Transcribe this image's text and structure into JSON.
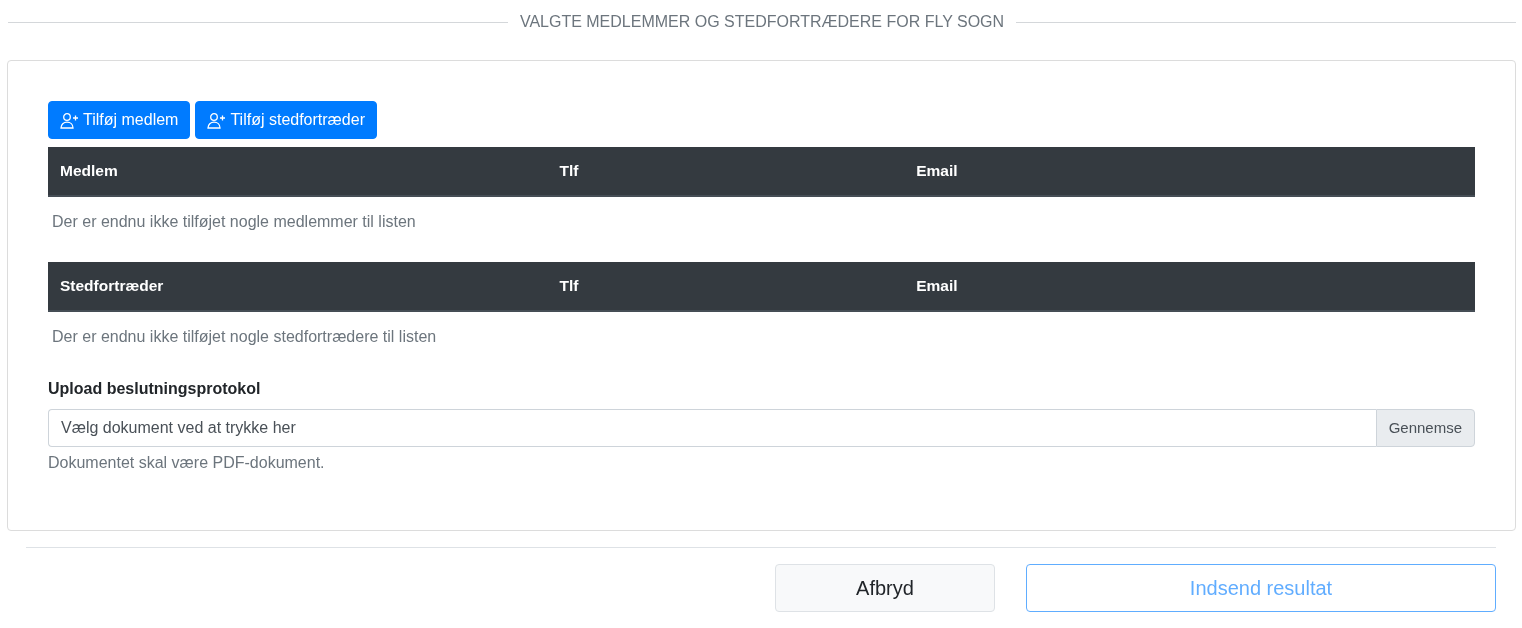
{
  "section_title": "VALGTE MEDLEMMER OG STEDFORTRÆDERE FOR FLY SOGN",
  "actions": [
    {
      "label": "Tilføj medlem"
    },
    {
      "label": "Tilføj stedfortræder"
    }
  ],
  "tables": [
    {
      "columns": [
        "Medlem",
        "Tlf",
        "Email"
      ],
      "empty_message": "Der er endnu ikke tilføjet nogle medlemmer til listen"
    },
    {
      "columns": [
        "Stedfortræder",
        "Tlf",
        "Email"
      ],
      "empty_message": "Der er endnu ikke tilføjet nogle stedfortrædere til listen"
    }
  ],
  "upload": {
    "label": "Upload beslutningsprotokol",
    "placeholder": "Vælg dokument ved at trykke her",
    "browse_label": "Gennemse",
    "help": "Dokumentet skal være PDF-dokument."
  },
  "footer_buttons": [
    {
      "label": "Afbryd",
      "kind": "cancel",
      "disabled": false
    },
    {
      "label": "Indsend resultat",
      "kind": "submit",
      "disabled": true
    }
  ]
}
